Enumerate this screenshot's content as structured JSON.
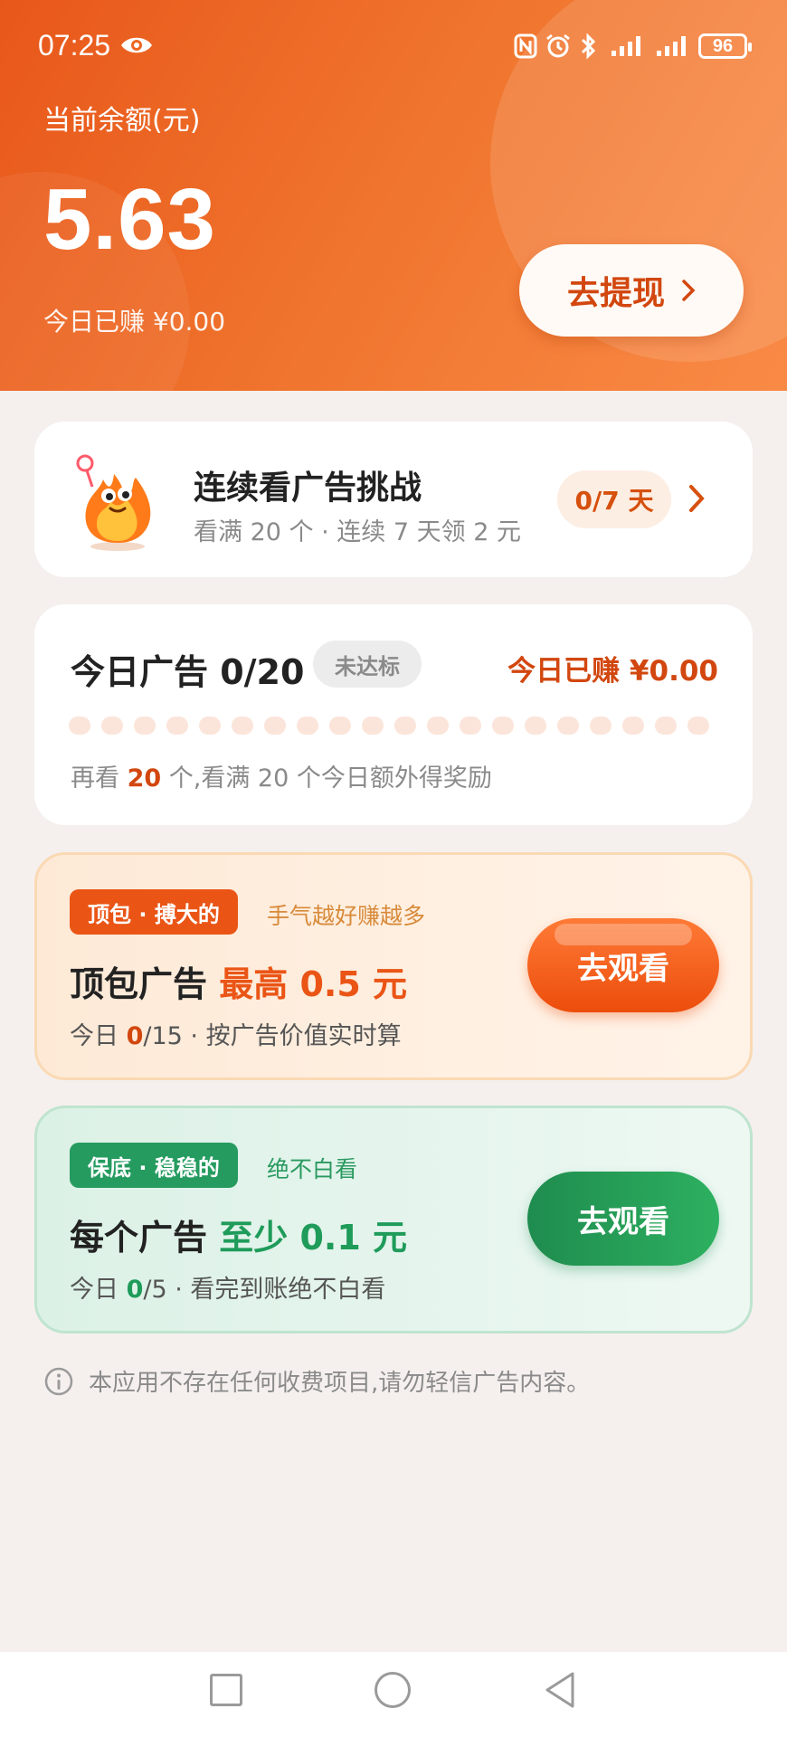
{
  "status_bar": {
    "time": "07:25",
    "battery": "96"
  },
  "header": {
    "balance_label": "当前余额(元)",
    "balance_value": "5.63",
    "earned_today": "今日已赚 ¥0.00",
    "withdraw_label": "去提现"
  },
  "challenge": {
    "title": "连续看广告挑战",
    "subtitle": "看满 20 个 · 连续 7 天领 2 元",
    "progress_pill": "0/7 天"
  },
  "today_ads": {
    "title": "今日广告 0/20",
    "badge": "未达标",
    "earned": "今日已赚 ¥0.00",
    "watched": 0,
    "total": 20,
    "hint_prefix": "再看 ",
    "hint_count": "20",
    "hint_suffix": " 个,看满 20 个今日额外得奖励"
  },
  "promo_big": {
    "tag": "顶包 · 搏大的",
    "note": "手气越好赚越多",
    "title_main": "顶包广告 ",
    "title_accent": "最高 0.5 元",
    "sub_prefix": "今日 ",
    "sub_count": "0",
    "sub_suffix": "/15 · 按广告价值实时算",
    "button": "去观看"
  },
  "promo_safe": {
    "tag": "保底 · 稳稳的",
    "note": "绝不白看",
    "title_main": "每个广告 ",
    "title_accent": "至少 0.1 元",
    "sub_prefix": "今日 ",
    "sub_count": "0",
    "sub_suffix": "/5 · 看完到账绝不白看",
    "button": "去观看"
  },
  "disclaimer": "本应用不存在任何收费项目,请勿轻信广告内容。",
  "colors": {
    "brand_orange": "#ea5516",
    "accent_green": "#1f9b5a",
    "background": "#f5f0ee"
  },
  "icons": [
    "eye-icon",
    "nfc-icon",
    "alarm-icon",
    "bluetooth-icon",
    "signal-icon",
    "chevron-right-icon",
    "info-icon",
    "mascot-fire-icon",
    "nav-recents-icon",
    "nav-home-icon",
    "nav-back-icon"
  ]
}
